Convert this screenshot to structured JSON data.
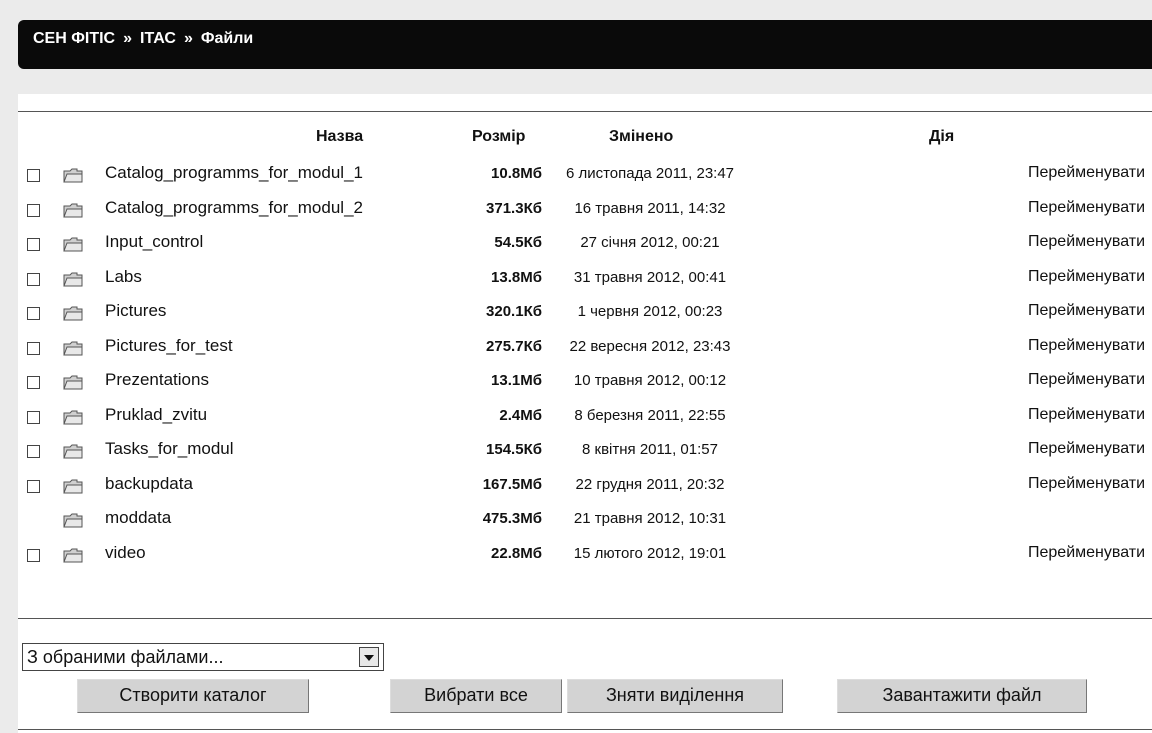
{
  "breadcrumb": {
    "part1": "СЕН ФІТІС",
    "sep": "»",
    "part2": "ІТАС",
    "part3": "Файли"
  },
  "table": {
    "headers": {
      "name": "Назва",
      "size": "Розмір",
      "modified": "Змінено",
      "action": "Дія"
    },
    "rows": [
      {
        "name": "Catalog_programms_for_modul_1",
        "size": "10.8Мб",
        "date": "6 листопада 2011, 23:47",
        "action": "Перейменувати",
        "checkbox": true
      },
      {
        "name": "Catalog_programms_for_modul_2",
        "size": "371.3Кб",
        "date": "16 травня 2011, 14:32",
        "action": "Перейменувати",
        "checkbox": true
      },
      {
        "name": "Input_control",
        "size": "54.5Кб",
        "date": "27 січня 2012, 00:21",
        "action": "Перейменувати",
        "checkbox": true
      },
      {
        "name": "Labs",
        "size": "13.8Мб",
        "date": "31 травня 2012, 00:41",
        "action": "Перейменувати",
        "checkbox": true
      },
      {
        "name": "Pictures",
        "size": "320.1Кб",
        "date": "1 червня 2012, 00:23",
        "action": "Перейменувати",
        "checkbox": true
      },
      {
        "name": "Pictures_for_test",
        "size": "275.7Кб",
        "date": "22 вересня 2012, 23:43",
        "action": "Перейменувати",
        "checkbox": true
      },
      {
        "name": "Prezentations",
        "size": "13.1Мб",
        "date": "10 травня 2012, 00:12",
        "action": "Перейменувати",
        "checkbox": true
      },
      {
        "name": "Pruklad_zvitu",
        "size": "2.4Мб",
        "date": "8 березня 2011, 22:55",
        "action": "Перейменувати",
        "checkbox": true
      },
      {
        "name": "Tasks_for_modul",
        "size": "154.5Кб",
        "date": "8 квітня 2011, 01:57",
        "action": "Перейменувати",
        "checkbox": true
      },
      {
        "name": "backupdata",
        "size": "167.5Мб",
        "date": "22 грудня 2011, 20:32",
        "action": "Перейменувати",
        "checkbox": true
      },
      {
        "name": "moddata",
        "size": "475.3Мб",
        "date": "21 травня 2012, 10:31",
        "action": "",
        "checkbox": false
      },
      {
        "name": "video",
        "size": "22.8Мб",
        "date": "15 лютого 2012, 19:01",
        "action": "Перейменувати",
        "checkbox": true
      }
    ]
  },
  "controls": {
    "with_selected": "З обраними файлами...",
    "create_folder": "Створити каталог",
    "select_all": "Вибрати все",
    "deselect": "Зняти виділення",
    "upload": "Завантажити файл"
  },
  "colors": {
    "nav_bg": "#0a0a0a",
    "button_bg": "#d3d3d3",
    "frame_bg": "#ebebeb"
  },
  "icons": {
    "row_icon": "folder-icon",
    "dropdown_icon": "dropdown-arrow-icon"
  }
}
